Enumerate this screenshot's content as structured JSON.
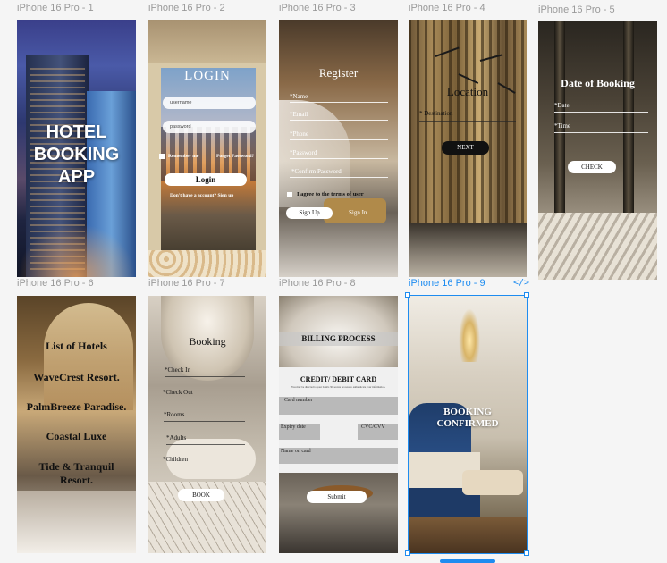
{
  "frames": [
    {
      "label": "iPhone 16 Pro - 1",
      "title_lines": [
        "HOTEL",
        "BOOKING",
        "APP"
      ]
    },
    {
      "label": "iPhone 16 Pro - 2",
      "title": "LOGIN",
      "username_placeholder": "username",
      "password_placeholder": "password",
      "remember": "Remember me",
      "forgot": "Forget Password?",
      "button": "Login",
      "signup_prompt": "Don't have a account?  Sign up"
    },
    {
      "label": "iPhone 16 Pro - 3",
      "title": "Register",
      "fields": [
        "*Name",
        "*Email",
        "*Phone",
        "*Password",
        "*Confirm Password"
      ],
      "terms": "I agree to the terms of user",
      "button": "Sign Up",
      "link": "Sign In"
    },
    {
      "label": "iPhone 16 Pro - 4",
      "title": "Location",
      "field": "* Destination",
      "button": "NEXT"
    },
    {
      "label": "iPhone 16 Pro - 5",
      "title": "Date of Booking",
      "fields": [
        "*Date",
        "*Time"
      ],
      "button": "CHECK"
    },
    {
      "label": "iPhone 16 Pro - 6",
      "title": "List of Hotels",
      "hotels": [
        "WaveCrest Resort.",
        "PalmBreeze Paradise.",
        "Coastal Luxe",
        "Tide & Tranquil Resort."
      ]
    },
    {
      "label": "iPhone 16 Pro - 7",
      "title": "Booking",
      "fields": [
        "*Check In",
        "*Check Out",
        "*Rooms",
        "*Adults",
        "*Children"
      ],
      "button": "BOOK"
    },
    {
      "label": "iPhone 16 Pro - 8",
      "title": "BILLING PROCESS",
      "card_title": "CREDIT/ DEBIT CARD",
      "card_sub": "You may be directed to your bank's 3D secure process to authenticate your information.",
      "card_number": "Card number",
      "expiry": "Expiry date",
      "cvc": "CVC/CVV",
      "name": "Name on card",
      "button": "Submit"
    },
    {
      "label": "iPhone 16 Pro - 9",
      "title_lines": [
        "BOOKING",
        "CONFIRMED"
      ],
      "code_icon": "</>"
    }
  ],
  "colors": {
    "selection": "#1e8cf0",
    "frame_label": "#9a9a9a"
  }
}
